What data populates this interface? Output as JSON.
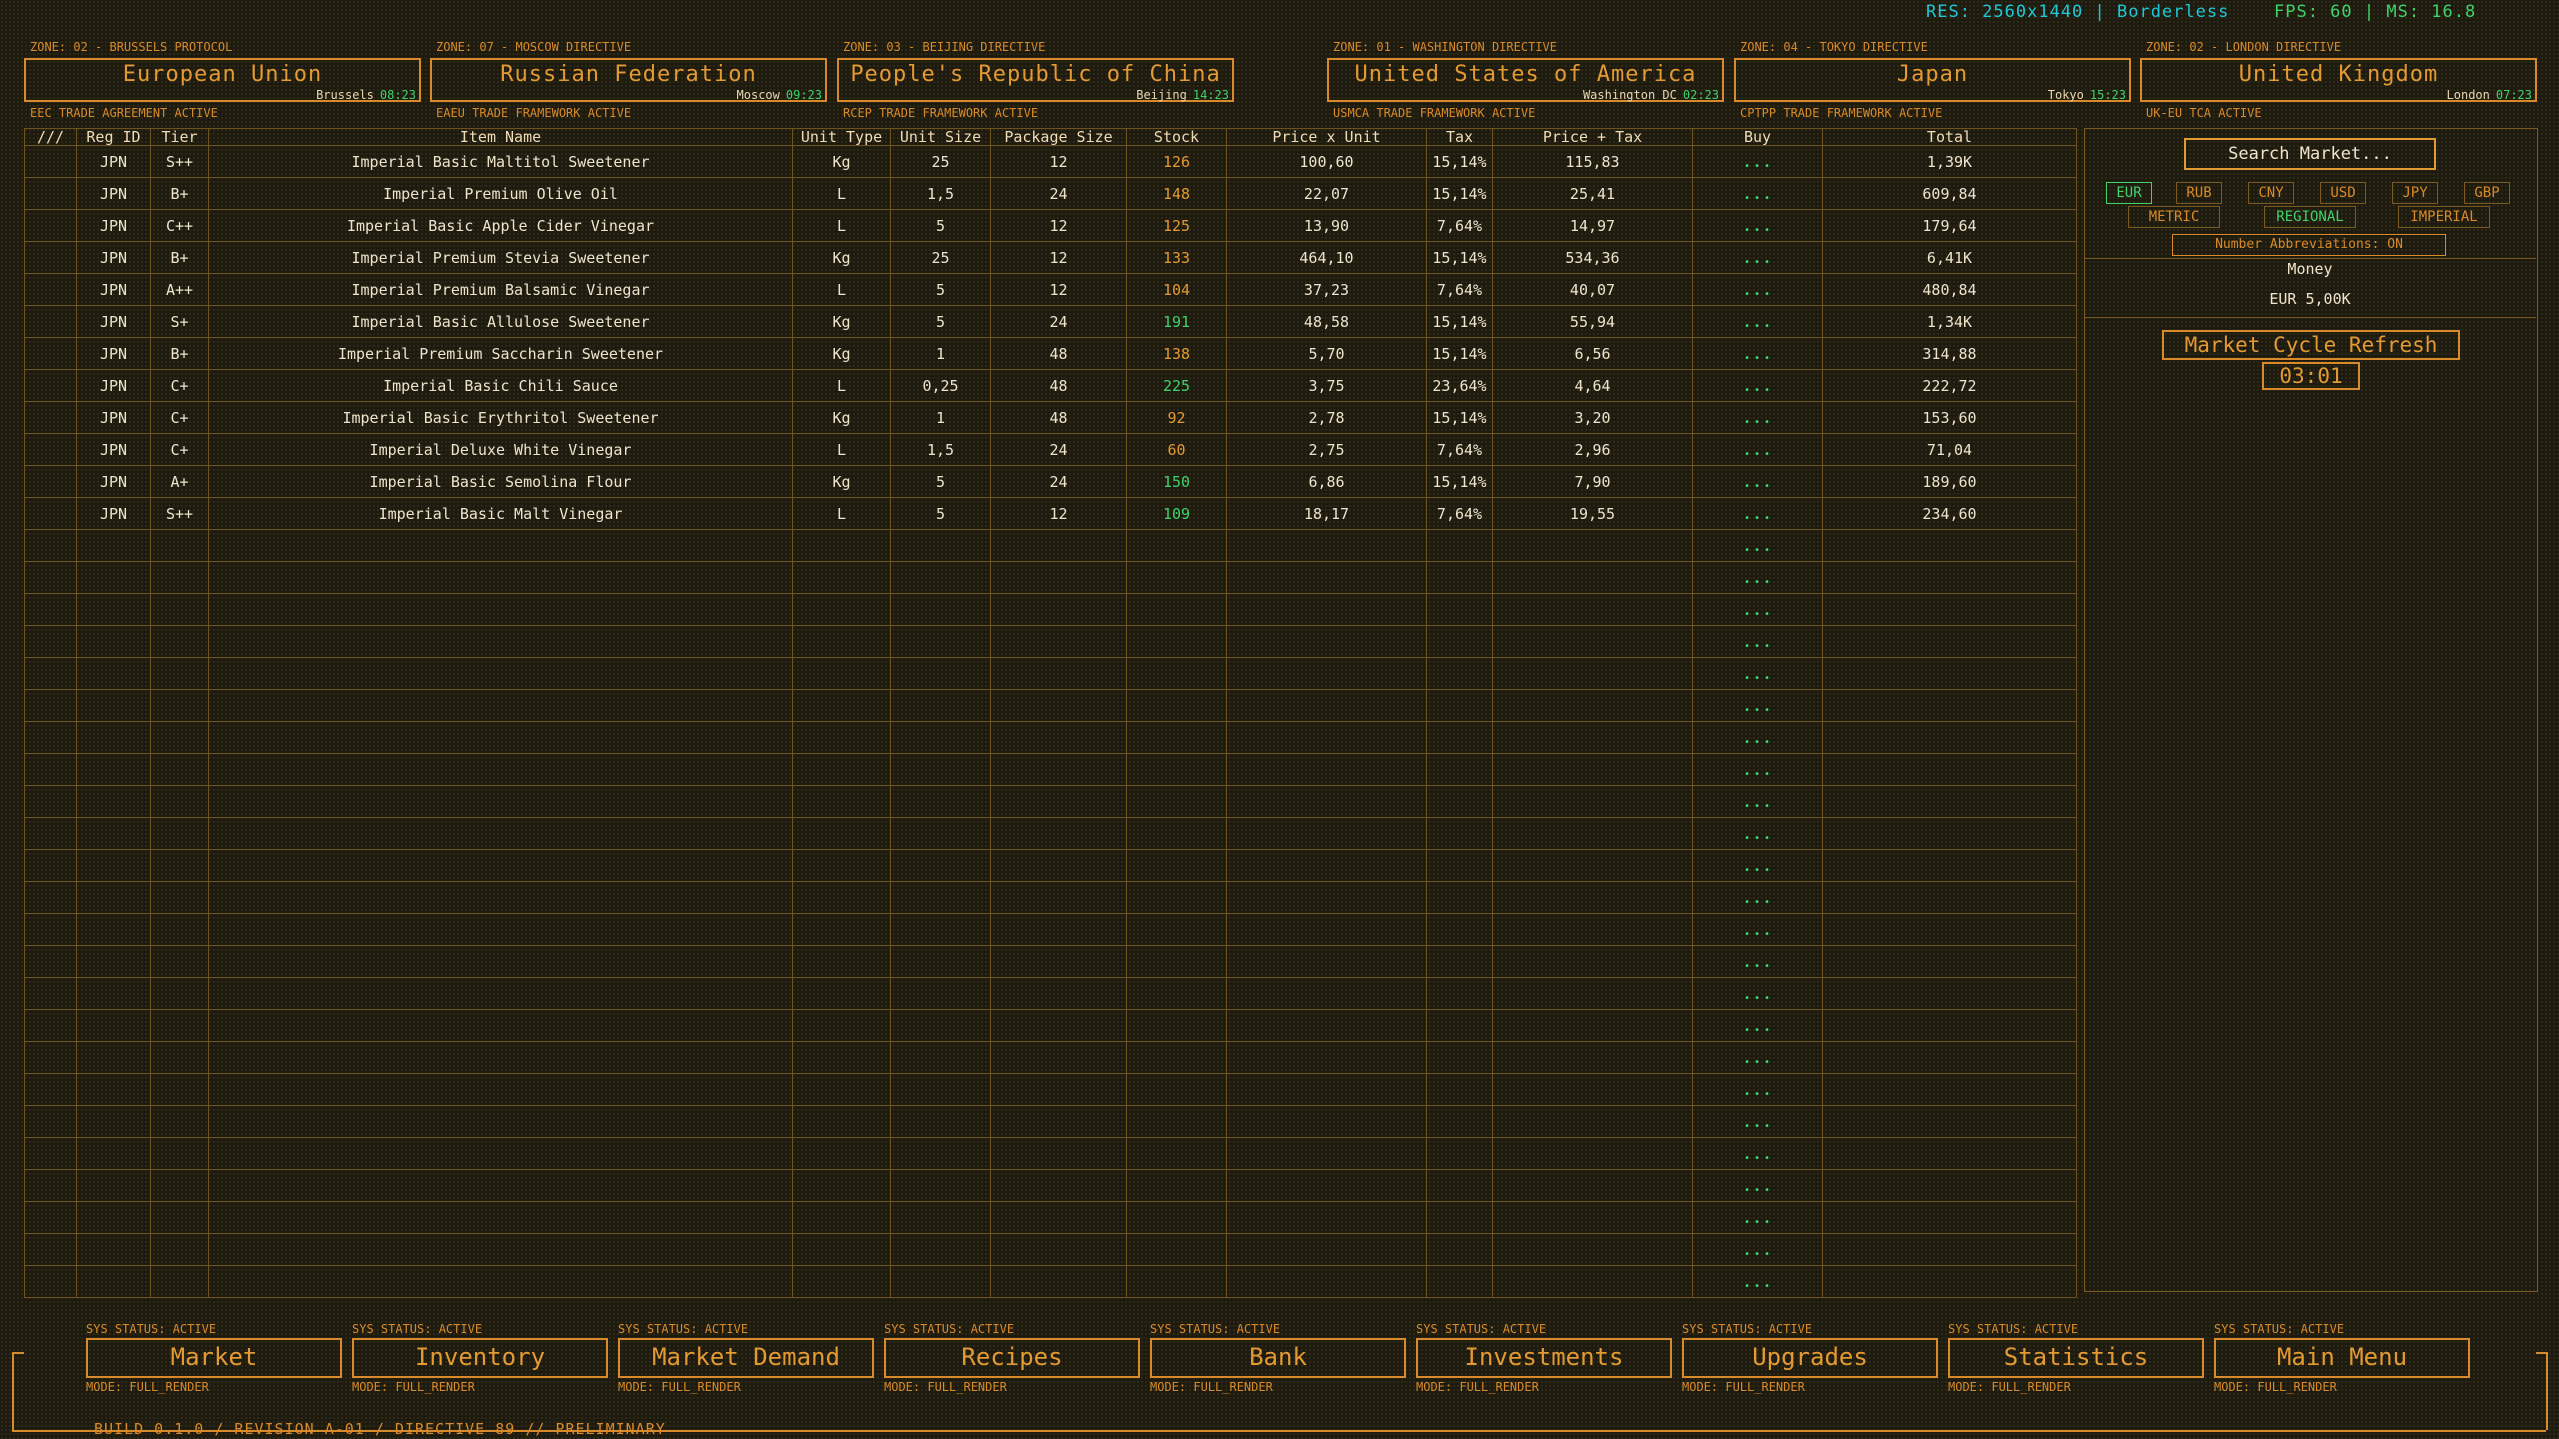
{
  "status_bar": {
    "res": "RES: 2560x1440 | Borderless",
    "fps": "FPS: 60 | MS: 16.8"
  },
  "zones": [
    {
      "label": "ZONE: 02 - BRUSSELS PROTOCOL",
      "name": "European Union",
      "city": "Brussels",
      "time": "08:23",
      "framework": "EEC TRADE AGREEMENT ACTIVE"
    },
    {
      "label": "ZONE: 07 - MOSCOW DIRECTIVE",
      "name": "Russian Federation",
      "city": "Moscow",
      "time": "09:23",
      "framework": "EAEU TRADE FRAMEWORK ACTIVE"
    },
    {
      "label": "ZONE: 03 - BEIJING DIRECTIVE",
      "name": "People's Republic of China",
      "city": "Beijing",
      "time": "14:23",
      "framework": "RCEP TRADE FRAMEWORK ACTIVE"
    },
    {
      "label": "ZONE: 01 - WASHINGTON DIRECTIVE",
      "name": "United States of America",
      "city": "Washington DC",
      "time": "02:23",
      "framework": "USMCA TRADE FRAMEWORK ACTIVE"
    },
    {
      "label": "ZONE: 04 - TOKYO DIRECTIVE",
      "name": "Japan",
      "city": "Tokyo",
      "time": "15:23",
      "framework": "CPTPP TRADE FRAMEWORK ACTIVE"
    },
    {
      "label": "ZONE: 02 - LONDON DIRECTIVE",
      "name": "United Kingdom",
      "city": "London",
      "time": "07:23",
      "framework": "UK-EU TCA ACTIVE"
    }
  ],
  "table": {
    "headers": [
      "///",
      "Reg ID",
      "Tier",
      "Item Name",
      "Unit Type",
      "Unit Size",
      "Package Size",
      "Stock",
      "Price x Unit",
      "Tax",
      "Price + Tax",
      "Buy",
      "Total"
    ],
    "buy_label": "...",
    "rows": [
      {
        "reg": "JPN",
        "tier": "S++",
        "name": "Imperial Basic Maltitol Sweetener",
        "unit": "Kg",
        "size": "25",
        "pkg": "12",
        "stock": "126",
        "stock_color": "o",
        "price": "100,60",
        "tax": "15,14%",
        "ptax": "115,83",
        "total": "1,39K"
      },
      {
        "reg": "JPN",
        "tier": "B+",
        "name": "Imperial Premium Olive Oil",
        "unit": "L",
        "size": "1,5",
        "pkg": "24",
        "stock": "148",
        "stock_color": "o",
        "price": "22,07",
        "tax": "15,14%",
        "ptax": "25,41",
        "total": "609,84"
      },
      {
        "reg": "JPN",
        "tier": "C++",
        "name": "Imperial Basic Apple Cider Vinegar",
        "unit": "L",
        "size": "5",
        "pkg": "12",
        "stock": "125",
        "stock_color": "o",
        "price": "13,90",
        "tax": "7,64%",
        "ptax": "14,97",
        "total": "179,64"
      },
      {
        "reg": "JPN",
        "tier": "B+",
        "name": "Imperial Premium Stevia Sweetener",
        "unit": "Kg",
        "size": "25",
        "pkg": "12",
        "stock": "133",
        "stock_color": "o",
        "price": "464,10",
        "tax": "15,14%",
        "ptax": "534,36",
        "total": "6,41K"
      },
      {
        "reg": "JPN",
        "tier": "A++",
        "name": "Imperial Premium Balsamic Vinegar",
        "unit": "L",
        "size": "5",
        "pkg": "12",
        "stock": "104",
        "stock_color": "o",
        "price": "37,23",
        "tax": "7,64%",
        "ptax": "40,07",
        "total": "480,84"
      },
      {
        "reg": "JPN",
        "tier": "S+",
        "name": "Imperial Basic Allulose Sweetener",
        "unit": "Kg",
        "size": "5",
        "pkg": "24",
        "stock": "191",
        "stock_color": "g",
        "price": "48,58",
        "tax": "15,14%",
        "ptax": "55,94",
        "total": "1,34K"
      },
      {
        "reg": "JPN",
        "tier": "B+",
        "name": "Imperial Premium Saccharin Sweetener",
        "unit": "Kg",
        "size": "1",
        "pkg": "48",
        "stock": "138",
        "stock_color": "o",
        "price": "5,70",
        "tax": "15,14%",
        "ptax": "6,56",
        "total": "314,88"
      },
      {
        "reg": "JPN",
        "tier": "C+",
        "name": "Imperial Basic Chili Sauce",
        "unit": "L",
        "size": "0,25",
        "pkg": "48",
        "stock": "225",
        "stock_color": "g",
        "price": "3,75",
        "tax": "23,64%",
        "ptax": "4,64",
        "total": "222,72"
      },
      {
        "reg": "JPN",
        "tier": "C+",
        "name": "Imperial Basic Erythritol Sweetener",
        "unit": "Kg",
        "size": "1",
        "pkg": "48",
        "stock": "92",
        "stock_color": "o",
        "price": "2,78",
        "tax": "15,14%",
        "ptax": "3,20",
        "total": "153,60"
      },
      {
        "reg": "JPN",
        "tier": "C+",
        "name": "Imperial Deluxe White Vinegar",
        "unit": "L",
        "size": "1,5",
        "pkg": "24",
        "stock": "60",
        "stock_color": "o",
        "price": "2,75",
        "tax": "7,64%",
        "ptax": "2,96",
        "total": "71,04"
      },
      {
        "reg": "JPN",
        "tier": "A+",
        "name": "Imperial Basic Semolina Flour",
        "unit": "Kg",
        "size": "5",
        "pkg": "24",
        "stock": "150",
        "stock_color": "g",
        "price": "6,86",
        "tax": "15,14%",
        "ptax": "7,90",
        "total": "189,60"
      },
      {
        "reg": "JPN",
        "tier": "S++",
        "name": "Imperial Basic Malt Vinegar",
        "unit": "L",
        "size": "5",
        "pkg": "12",
        "stock": "109",
        "stock_color": "g",
        "price": "18,17",
        "tax": "7,64%",
        "ptax": "19,55",
        "total": "234,60"
      }
    ],
    "empty_rows": 24
  },
  "sidebar": {
    "search_placeholder": "Search Market...",
    "currencies": [
      "EUR",
      "RUB",
      "CNY",
      "USD",
      "JPY",
      "GBP"
    ],
    "selected_currency": "EUR",
    "units": [
      "METRIC",
      "REGIONAL",
      "IMPERIAL"
    ],
    "selected_unit": "REGIONAL",
    "abbreviations": "Number Abbreviations: ON",
    "money_label": "Money",
    "money_value": "EUR 5,00K",
    "cycle_label": "Market Cycle Refresh",
    "cycle_timer": "03:01"
  },
  "nav": {
    "sys_status": "SYS STATUS: ACTIVE",
    "mode": "MODE: FULL_RENDER",
    "items": [
      "Market",
      "Inventory",
      "Market Demand",
      "Recipes",
      "Bank",
      "Investments",
      "Upgrades",
      "Statistics",
      "Main Menu"
    ]
  },
  "build": "BUILD 0.1.0 / REVISION A-01 / DIRECTIVE 89 // PRELIMINARY",
  "colors": {
    "accent": "#e39a32",
    "positive": "#3fd36a",
    "info": "#1ec8d8",
    "background": "#1d1a0f"
  }
}
